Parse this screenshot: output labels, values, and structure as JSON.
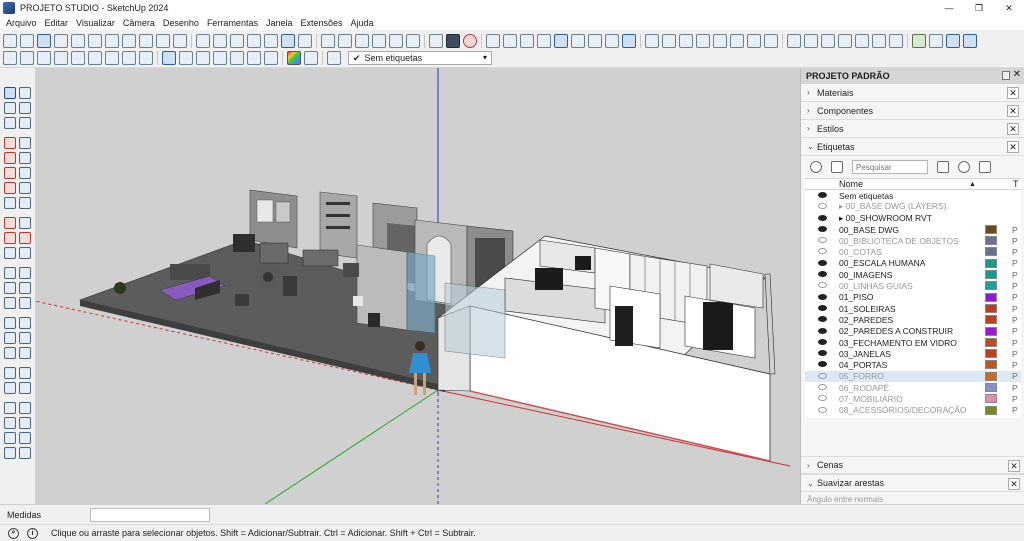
{
  "window": {
    "title": "PROJETO STUDIO - SketchUp 2024",
    "controls": {
      "minimize": "—",
      "maximize": "❐",
      "close": "✕"
    }
  },
  "menu": [
    "Arquivo",
    "Editar",
    "Visualizar",
    "Câmera",
    "Desenho",
    "Ferramentas",
    "Janela",
    "Extensões",
    "Ajuda"
  ],
  "tag_selector": {
    "value": "Sem etiquetas"
  },
  "panel": {
    "title": "PROJETO PADRÃO",
    "trays": [
      "Materiais",
      "Componentes",
      "Estilos",
      "Etiquetas"
    ],
    "tags": {
      "search_placeholder": "Pesquisar",
      "col_name": "Nome",
      "col_t": "T",
      "rows": [
        {
          "name": "Sem etiquetas",
          "visible": true,
          "color": ""
        },
        {
          "name": "▸ 00_BASE DWG (LAYERS)",
          "visible": false,
          "color": ""
        },
        {
          "name": "▸ 00_SHOWROOM RVT",
          "visible": true,
          "color": ""
        },
        {
          "name": "00_BASE DWG",
          "visible": true,
          "color": "#6b4a1e"
        },
        {
          "name": "00_BIBLIOTECA DE OBJETOS",
          "visible": false,
          "color": "#6f6f8f"
        },
        {
          "name": "00_COTAS",
          "visible": false,
          "color": "#6a7389"
        },
        {
          "name": "00_ESCALA HUMANA",
          "visible": true,
          "color": "#1b9a8a"
        },
        {
          "name": "00_IMAGENS",
          "visible": true,
          "color": "#159c8f"
        },
        {
          "name": "00_LINHAS GUIAS",
          "visible": false,
          "color": "#1aa39a"
        },
        {
          "name": "01_PISO",
          "visible": true,
          "color": "#8a1bd6"
        },
        {
          "name": "01_SOLEIRAS",
          "visible": true,
          "color": "#c23a1a"
        },
        {
          "name": "02_PAREDES",
          "visible": true,
          "color": "#b5451b"
        },
        {
          "name": "02_PAREDES A CONSTRUIR",
          "visible": true,
          "color": "#9a16d2"
        },
        {
          "name": "03_FECHAMENTO EM VIDRO",
          "visible": true,
          "color": "#c24a18"
        },
        {
          "name": "03_JANELAS",
          "visible": true,
          "color": "#b8431a"
        },
        {
          "name": "04_PORTAS",
          "visible": true,
          "color": "#c8541c"
        },
        {
          "name": "05_FORRO",
          "visible": false,
          "color": "#d26a1e",
          "highlight": true
        },
        {
          "name": "06_RODAPÉ",
          "visible": false,
          "color": "#8c8cc8"
        },
        {
          "name": "07_MOBILIÁRIO",
          "visible": false,
          "color": "#e28cb0"
        },
        {
          "name": "08_ACESSÓRIOS/DECORAÇÃO",
          "visible": false,
          "color": "#7a8a1c"
        }
      ]
    },
    "bottom_trays": [
      "Cenas",
      "Suavizar arestas"
    ],
    "bottom_sub": "Ângulo entre normais"
  },
  "measurements": {
    "label": "Medidas",
    "value": ""
  },
  "status": {
    "message": "Clique ou arraste para selecionar objetos. Shift = Adicionar/Subtrair. Ctrl = Adicionar. Shift + Ctrl = Subtrair."
  }
}
